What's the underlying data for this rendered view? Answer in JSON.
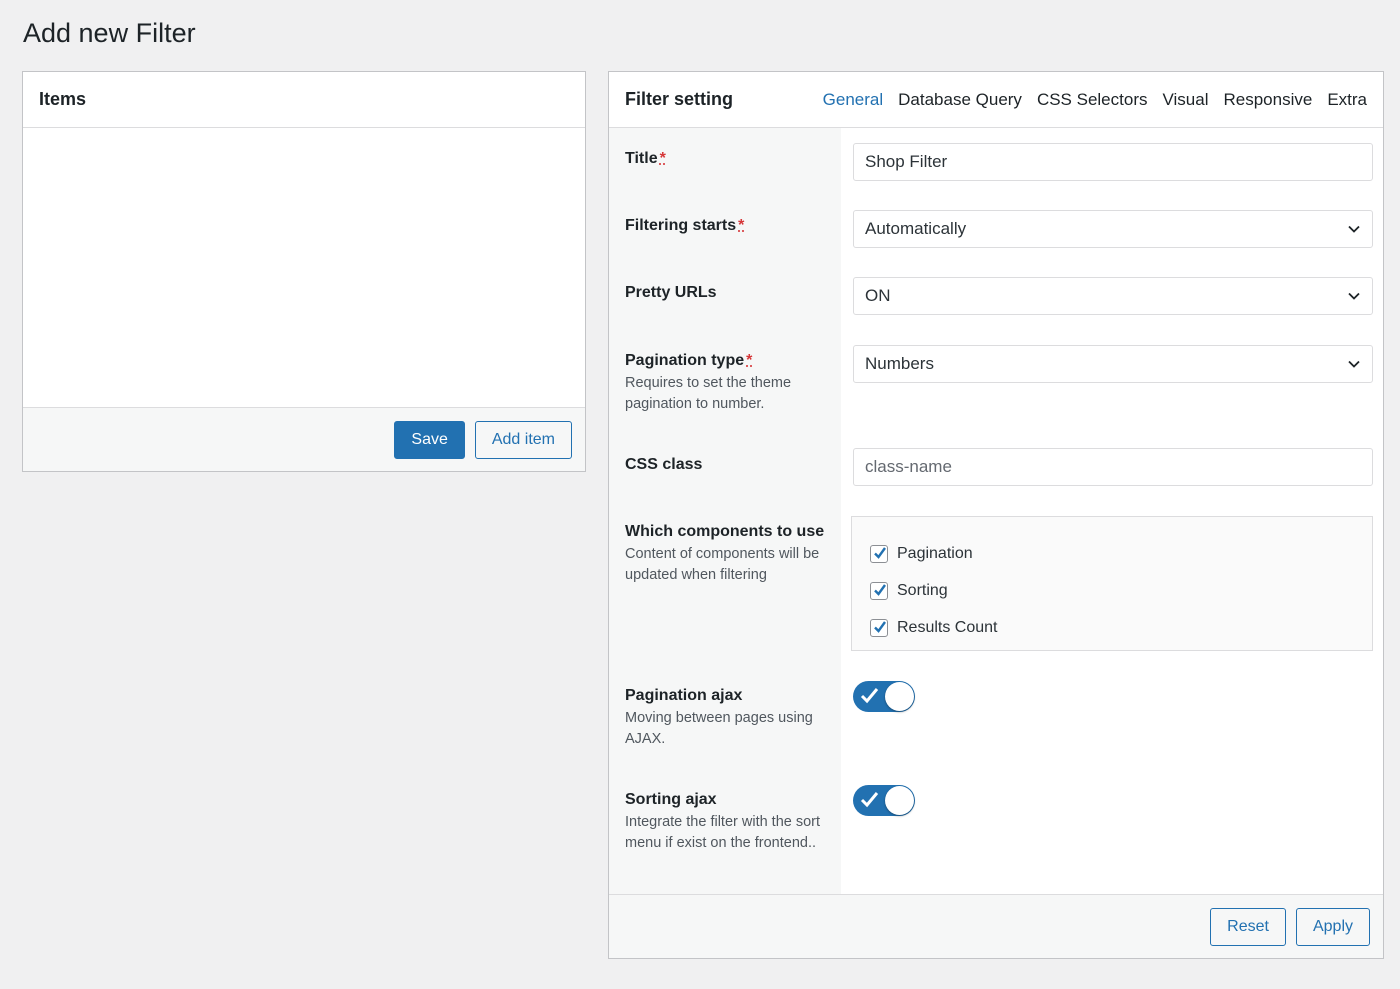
{
  "page": {
    "title": "Add new Filter"
  },
  "items_panel": {
    "title": "Items",
    "save_label": "Save",
    "add_item_label": "Add item"
  },
  "settings_panel": {
    "title": "Filter setting",
    "tabs": [
      {
        "label": "General",
        "active": true
      },
      {
        "label": "Database Query",
        "active": false
      },
      {
        "label": "CSS Selectors",
        "active": false
      },
      {
        "label": "Visual",
        "active": false
      },
      {
        "label": "Responsive",
        "active": false
      },
      {
        "label": "Extra",
        "active": false
      }
    ],
    "required_mark": "*",
    "fields": {
      "title": {
        "label": "Title",
        "value": "Shop Filter"
      },
      "filtering_starts": {
        "label": "Filtering starts",
        "value": "Automatically"
      },
      "pretty_urls": {
        "label": "Pretty URLs",
        "value": "ON"
      },
      "pagination_type": {
        "label": "Pagination type",
        "description": "Requires to set the theme pagination to number.",
        "value": "Numbers"
      },
      "css_class": {
        "label": "CSS class",
        "placeholder": "class-name",
        "value": ""
      },
      "components": {
        "label": "Which components to use",
        "description": "Content of components will be updated when filtering",
        "options": [
          {
            "label": "Pagination",
            "checked": true
          },
          {
            "label": "Sorting",
            "checked": true
          },
          {
            "label": "Results Count",
            "checked": true
          }
        ]
      },
      "pagination_ajax": {
        "label": "Pagination ajax",
        "description": "Moving between pages using AJAX.",
        "enabled": true
      },
      "sorting_ajax": {
        "label": "Sorting ajax",
        "description": "Integrate the filter with the sort menu if exist on the frontend..",
        "enabled": true
      }
    },
    "reset_label": "Reset",
    "apply_label": "Apply"
  },
  "colors": {
    "accent": "#2271b1",
    "required": "#d63638",
    "background": "#f0f0f1"
  }
}
